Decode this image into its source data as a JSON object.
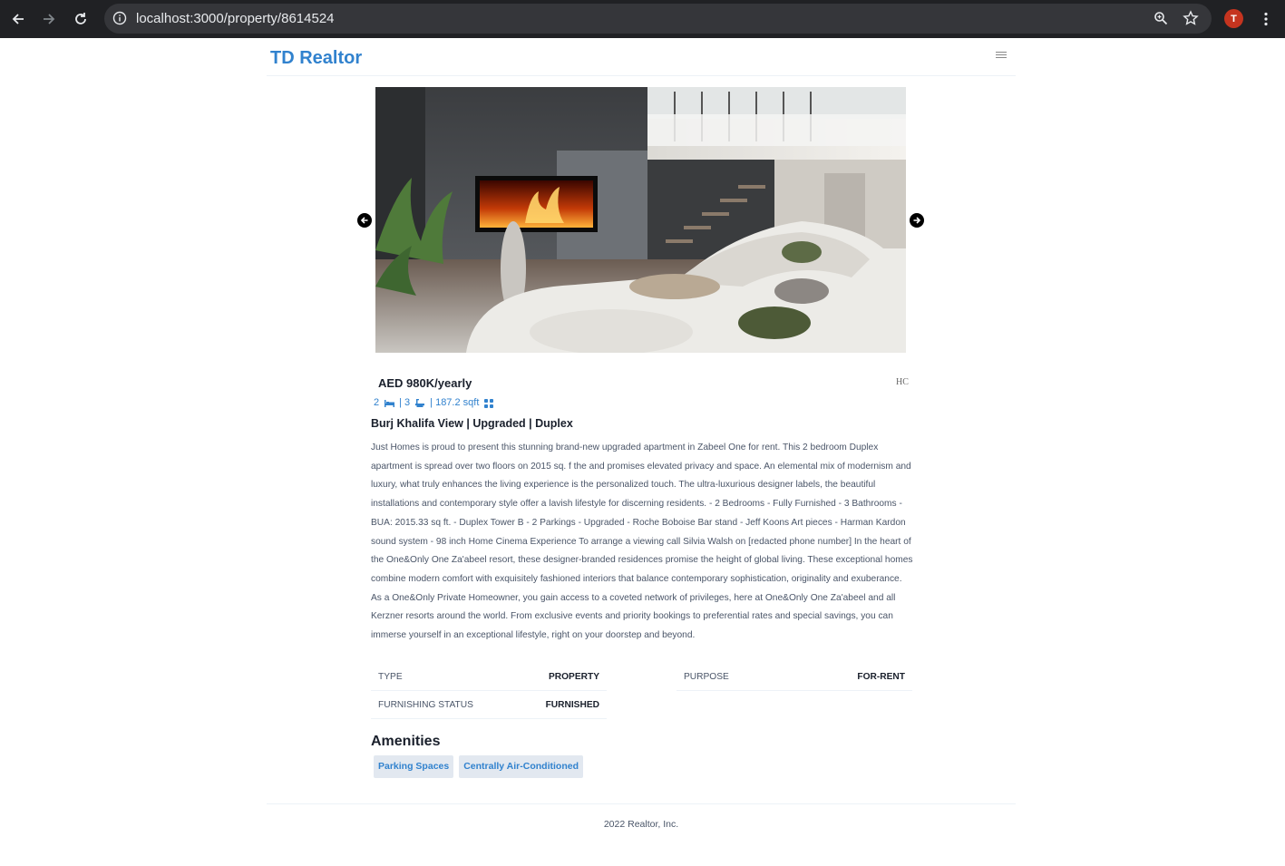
{
  "browser": {
    "url_host": "localhost",
    "url_path": ":3000/property/8614524",
    "avatar_letter": "T"
  },
  "navbar": {
    "brand": "TD Realtor",
    "brand_color": "#3182ce"
  },
  "carousel": {
    "prev_icon": "arrow-left-circle-icon",
    "next_icon": "arrow-right-circle-icon"
  },
  "property": {
    "price": "AED 980K/yearly",
    "agency_logo_text": "HC",
    "rooms": "2",
    "baths": "| 3",
    "area": "| 187.2 sqft",
    "title": "Burj Khalifa View | Upgraded | Duplex",
    "description": "Just Homes is proud to present this stunning brand-new upgraded apartment in Zabeel One for rent. This 2 bedroom Duplex apartment is spread over two floors on 2015 sq. f the and promises elevated privacy and space. An elemental mix of modernism and luxury, what truly enhances the living experience is the personalized touch. The ultra-luxurious designer labels, the beautiful installations and contemporary style offer a lavish lifestyle for discerning residents. - 2 Bedrooms - Fully Furnished - 3 Bathrooms - BUA: 2015.33 sq ft. - Duplex Tower B - 2 Parkings - Upgraded - Roche Boboise Bar stand - Jeff Koons Art pieces - Harman Kardon sound system - 98 inch Home Cinema Experience To arrange a viewing call Silvia Walsh on [redacted phone number] In the heart of the One&Only One Za'abeel resort, these designer-branded residences promise the height of global living. These exceptional homes combine modern comfort with exquisitely fashioned interiors that balance contemporary sophistication, originality and exuberance. As a One&Only Private Homeowner, you gain access to a coveted network of privileges, here at One&Only One Za'abeel and all Kerzner resorts around the world. From exclusive events and priority bookings to preferential rates and special savings, you can immerse yourself in an exceptional lifestyle, right on your doorstep and beyond."
  },
  "facts": [
    {
      "label": "TYPE",
      "value": "PROPERTY"
    },
    {
      "label": "PURPOSE",
      "value": "FOR-RENT"
    },
    {
      "label": "FURNISHING STATUS",
      "value": "FURNISHED"
    }
  ],
  "amenities": {
    "title": "Amenities",
    "items": [
      "Parking Spaces",
      "Centrally Air-Conditioned"
    ]
  },
  "footer": {
    "text": "2022 Realtor, Inc."
  }
}
